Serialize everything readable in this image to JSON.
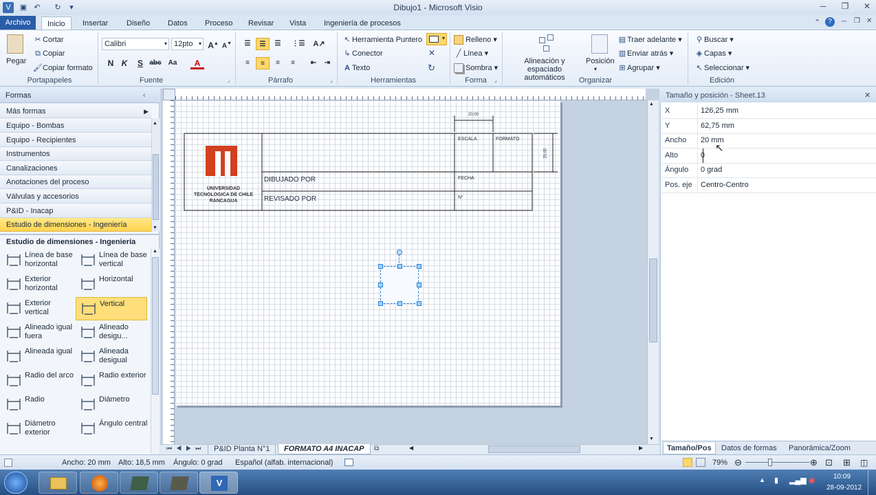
{
  "window": {
    "title": "Dibujo1  -  Microsoft Visio"
  },
  "tabs": [
    "Archivo",
    "Inicio",
    "Insertar",
    "Diseño",
    "Datos",
    "Proceso",
    "Revisar",
    "Vista",
    "Ingeniería de procesos"
  ],
  "ribbon": {
    "clipboard": {
      "paste": "Pegar",
      "cut": "Cortar",
      "copy": "Copiar",
      "format_painter": "Copiar formato",
      "label": "Portapapeles"
    },
    "font": {
      "family": "Calibri",
      "size": "12pto",
      "label": "Fuente"
    },
    "paragraph": {
      "label": "Párrafo"
    },
    "tools": {
      "pointer": "Herramienta Puntero",
      "connector": "Conector",
      "text": "Texto",
      "label": "Herramientas"
    },
    "shape": {
      "fill": "Relleno",
      "line": "Línea",
      "shadow": "Sombra",
      "label": "Forma"
    },
    "arrange": {
      "autoalign": "Alineación y espaciado automáticos",
      "position": "Posición",
      "bring_front": "Traer adelante",
      "send_back": "Enviar atrás",
      "group": "Agrupar",
      "label": "Organizar"
    },
    "editing": {
      "find": "Buscar",
      "layers": "Capas",
      "select": "Seleccionar",
      "label": "Edición"
    }
  },
  "shapes": {
    "header": "Formas",
    "more": "Más formas",
    "stencils": [
      "Equipo - Bombas",
      "Equipo - Recipientes",
      "Instrumentos",
      "Canalizaciones",
      "Anotaciones del proceso",
      "Válvulas y accesorios",
      "P&ID - Inacap",
      "Estudio de dimensiones - Ingeniería"
    ],
    "selected_stencil": "Estudio de dimensiones - Ingeniería",
    "stencil_title": "Estudio de dimensiones - Ingeniería",
    "items": [
      {
        "label": "Línea de base horizontal",
        "icon": "baseline-horizontal-icon"
      },
      {
        "label": "Línea de base vertical",
        "icon": "baseline-vertical-icon"
      },
      {
        "label": "Exterior horizontal",
        "icon": "exterior-horizontal-icon"
      },
      {
        "label": "Horizontal",
        "icon": "horizontal-dimension-icon"
      },
      {
        "label": "Exterior vertical",
        "icon": "exterior-vertical-icon"
      },
      {
        "label": "Vertical",
        "icon": "vertical-dimension-icon"
      },
      {
        "label": "Alineado igual fuera",
        "icon": "aligned-out-icon"
      },
      {
        "label": "Alineado desigu...",
        "icon": "aligned-unequal-out-icon"
      },
      {
        "label": "Alineada igual",
        "icon": "aligned-equal-icon"
      },
      {
        "label": "Alineada desigual",
        "icon": "aligned-unequal-icon"
      },
      {
        "label": "Radio del arco",
        "icon": "arc-radius-icon"
      },
      {
        "label": "Radio exterior",
        "icon": "outer-radius-icon"
      },
      {
        "label": "Radio",
        "icon": "radius-icon"
      },
      {
        "label": "Diámetro",
        "icon": "diameter-icon"
      },
      {
        "label": "Diámetro exterior",
        "icon": "outer-diameter-icon"
      },
      {
        "label": "Ángulo central",
        "icon": "central-angle-icon"
      }
    ],
    "selected_item": "Vertical"
  },
  "drawing": {
    "title_block": {
      "logo_text": "UNIVERSIDAD TECNOLOGICA DE CHILE RANCAGUA",
      "escala": "ESCALA",
      "formato": "FORMATO",
      "dibujado": "DIBUJADO POR",
      "fecha": "FECHA",
      "revisado": "REVISADO POR",
      "numero": "N°"
    },
    "dim_h": "20,00",
    "dim_v": "20,00"
  },
  "page_tabs": [
    "P&ID  Planta N°1",
    "FORMATO A4 INACAP"
  ],
  "props": {
    "title": "Tamaño y posición - Sheet.13",
    "rows": [
      {
        "k": "X",
        "v": "126,25 mm"
      },
      {
        "k": "Y",
        "v": "62,75 mm"
      },
      {
        "k": "Ancho",
        "v": "20 mm"
      },
      {
        "k": "Alto",
        "v": "0"
      },
      {
        "k": "Ángulo",
        "v": "0 grad"
      },
      {
        "k": "Pos. eje",
        "v": "Centro-Centro"
      }
    ],
    "tabs": [
      "Tamaño/Pos",
      "Datos de formas",
      "Panorámica/Zoom"
    ]
  },
  "status": {
    "width": "Ancho: 20 mm",
    "height": "Alto: 18,5 mm",
    "angle": "Ángulo: 0 grad",
    "language": "Español (alfab. internacional)",
    "zoom": "79%"
  },
  "taskbar": {
    "time": "10:09",
    "date": "28-09-2012"
  }
}
